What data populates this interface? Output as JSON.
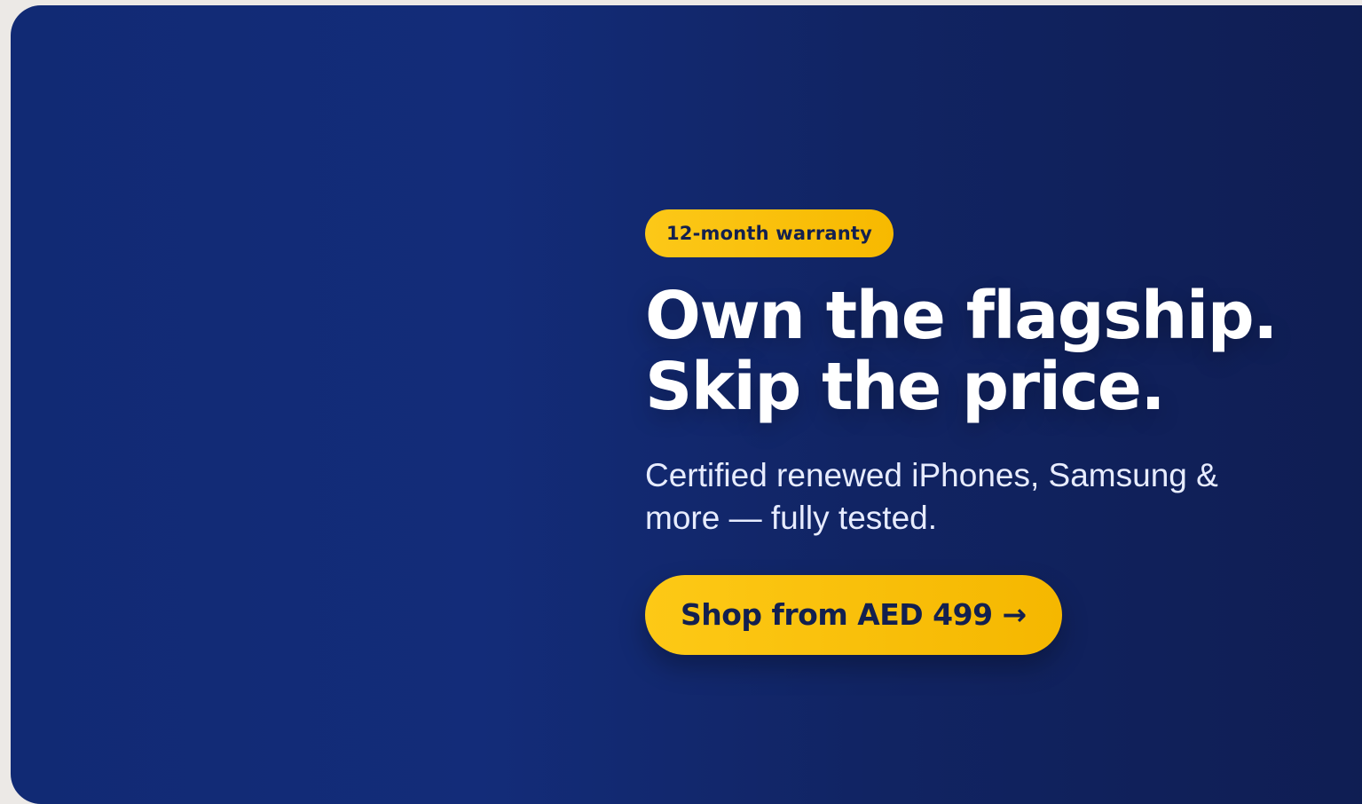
{
  "badge": {
    "label": "12-month warranty"
  },
  "headline": {
    "line1": "Own the flagship.",
    "line2": "Skip the price."
  },
  "subtitle": "Certified renewed iPhones, Samsung & more — fully tested.",
  "cta": {
    "label": "Shop from AED 499 →"
  },
  "colors": {
    "background_start": "#112a74",
    "background_end": "#0f1d52",
    "accent": "#fcc818",
    "text_dark": "#13204f"
  }
}
